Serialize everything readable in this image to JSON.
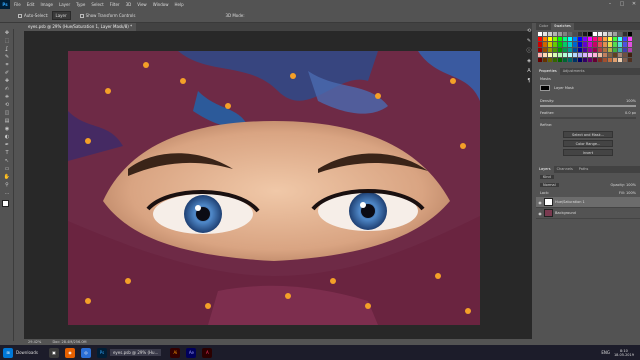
{
  "app": {
    "logo": "Ps",
    "menus": [
      "File",
      "Edit",
      "Image",
      "Layer",
      "Type",
      "Select",
      "Filter",
      "3D",
      "View",
      "Window",
      "Help"
    ],
    "window_controls": [
      "–",
      "□",
      "✕"
    ]
  },
  "options": {
    "auto_select": "Auto-Select:",
    "auto_select_value": "Layer",
    "show_transform": "Show Transform Controls",
    "mode_3d": "3D Mode:"
  },
  "document": {
    "tab_title": "eyes.psb @ 29% (Hue/Saturation 1, Layer Mask/8) *",
    "zoom": "29.42%",
    "doc_info": "Doc: 28.4M/256.0M"
  },
  "tools": [
    "move-icon",
    "marquee-icon",
    "lasso-icon",
    "quick-select-icon",
    "crop-icon",
    "eyedropper-icon",
    "healing-icon",
    "brush-icon",
    "stamp-icon",
    "history-brush-icon",
    "eraser-icon",
    "gradient-icon",
    "blur-icon",
    "dodge-icon",
    "pen-icon",
    "type-icon",
    "path-select-icon",
    "shape-icon",
    "hand-icon",
    "zoom-icon",
    "more-icon"
  ],
  "tool_glyphs": [
    "✥",
    "⬚",
    "ʆ",
    "✎",
    "⌗",
    "✐",
    "✚",
    "✍",
    "⎈",
    "⟲",
    "◫",
    "▤",
    "◉",
    "◐",
    "✒",
    "T",
    "↖",
    "▭",
    "✋",
    "⚲",
    "…"
  ],
  "panels": {
    "swatches_tabs": [
      "Color",
      "Swatches"
    ],
    "properties_tabs": [
      "Properties",
      "Adjustments"
    ],
    "masks_label": "Masks",
    "layer_mask_label": "Layer Mask",
    "density_label": "Density:",
    "density_value": "100%",
    "density_fraction": 1.0,
    "feather_label": "Feather:",
    "feather_value": "0.0 px",
    "feather_fraction": 0.0,
    "refine_label": "Refine:",
    "buttons": [
      "Select and Mask...",
      "Color Range...",
      "Invert"
    ],
    "layers_tabs": [
      "Layers",
      "Channels",
      "Paths"
    ],
    "kind_label": "Kind",
    "blend_mode": "Normal",
    "opacity_label": "Opacity:",
    "opacity_value": "100%",
    "lock_label": "Lock:",
    "fill_label": "Fill:",
    "fill_value": "100%",
    "layers": [
      {
        "name": "Hue/Saturation 1",
        "selected": true,
        "thumb": "#ffffff"
      },
      {
        "name": "Background",
        "selected": false,
        "thumb": "#7a3a50"
      }
    ]
  },
  "taskbar": {
    "start_label": "Downloads",
    "ps_task": "eyes.psb @ 29% (Hu...",
    "time": "8:10",
    "date": "18.05.2019",
    "lang": "ENG"
  },
  "colors": {
    "swatch_rows": [
      [
        "#ffffff",
        "#e6e6e6",
        "#cccccc",
        "#b3b3b3",
        "#999999",
        "#808080",
        "#666666",
        "#4d4d4d",
        "#333333",
        "#1a1a1a",
        "#000000",
        "#ffffff",
        "#f2f2f2",
        "#e0e0e0",
        "#c0c0c0",
        "#a0a0a0",
        "#606060",
        "#303030",
        "#000000"
      ],
      [
        "#ff0000",
        "#ff8000",
        "#ffff00",
        "#80ff00",
        "#00ff00",
        "#00ff80",
        "#00ffff",
        "#0080ff",
        "#0000ff",
        "#8000ff",
        "#ff00ff",
        "#ff0080",
        "#ff4040",
        "#ffa040",
        "#ffff40",
        "#40ff40",
        "#40ffff",
        "#4040ff",
        "#ff40ff"
      ],
      [
        "#cc0000",
        "#cc6600",
        "#cccc00",
        "#66cc00",
        "#00cc00",
        "#00cc66",
        "#00cccc",
        "#0066cc",
        "#0000cc",
        "#6600cc",
        "#cc00cc",
        "#cc0066",
        "#e05050",
        "#e09050",
        "#e0e050",
        "#50e050",
        "#50e0e0",
        "#5050e0",
        "#e050e0"
      ],
      [
        "#990000",
        "#994c00",
        "#999900",
        "#4c9900",
        "#009900",
        "#00994c",
        "#009999",
        "#004c99",
        "#000099",
        "#4c0099",
        "#990099",
        "#99004c",
        "#b04040",
        "#b07040",
        "#b0b040",
        "#40b040",
        "#40b0b0",
        "#4040b0",
        "#b040b0"
      ],
      [
        "#ffb3b3",
        "#ffd9b3",
        "#ffffb3",
        "#d9ffb3",
        "#b3ffb3",
        "#b3ffd9",
        "#b3ffff",
        "#b3d9ff",
        "#b3b3ff",
        "#d9b3ff",
        "#ffb3ff",
        "#ffb3d9",
        "#f0c0a0",
        "#c08060",
        "#806040",
        "#604020",
        "#a08070",
        "#705040",
        "#402010"
      ],
      [
        "#660000",
        "#663300",
        "#666600",
        "#336600",
        "#006600",
        "#006633",
        "#006666",
        "#003366",
        "#000066",
        "#330066",
        "#660066",
        "#660033",
        "#803020",
        "#a05030",
        "#c07040",
        "#e0a070",
        "#f0d0b0",
        "#806050",
        "#503020"
      ]
    ]
  }
}
